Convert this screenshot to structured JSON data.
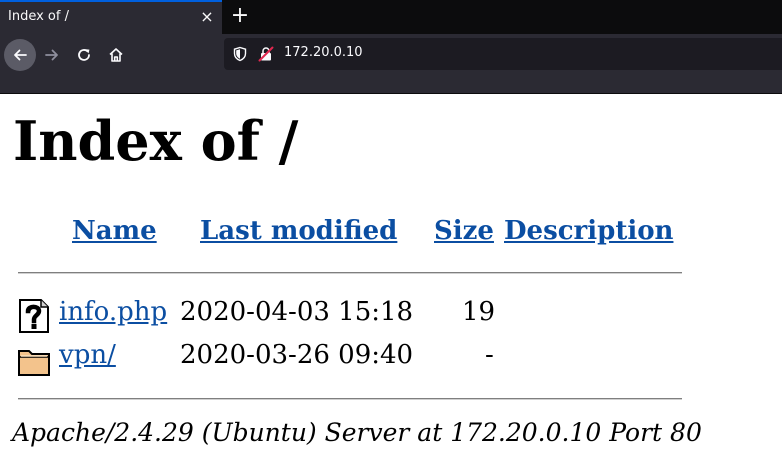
{
  "browser": {
    "tab_title": "Index of /",
    "tab_close_icon": "×",
    "new_tab_icon": "+",
    "url": "172.20.0.10"
  },
  "page": {
    "title": "Index of /",
    "columns": {
      "name": "Name",
      "last_modified": "Last modified",
      "size": "Size",
      "description": "Description"
    },
    "rows": [
      {
        "icon": "unknown-file-icon",
        "name": "info.php",
        "last_modified": "2020-04-03 15:18",
        "size": "19",
        "description": ""
      },
      {
        "icon": "folder-icon",
        "name": "vpn/",
        "last_modified": "2020-03-26 09:40",
        "size": "-",
        "description": ""
      }
    ],
    "address": "Apache/2.4.29 (Ubuntu) Server at 172.20.0.10 Port 80"
  },
  "colors": {
    "link": "#0b4ea2",
    "chrome_dark": "#0c0c0d",
    "chrome_toolbar": "#2b2a33",
    "urlbar_bg": "#1c1b22"
  }
}
